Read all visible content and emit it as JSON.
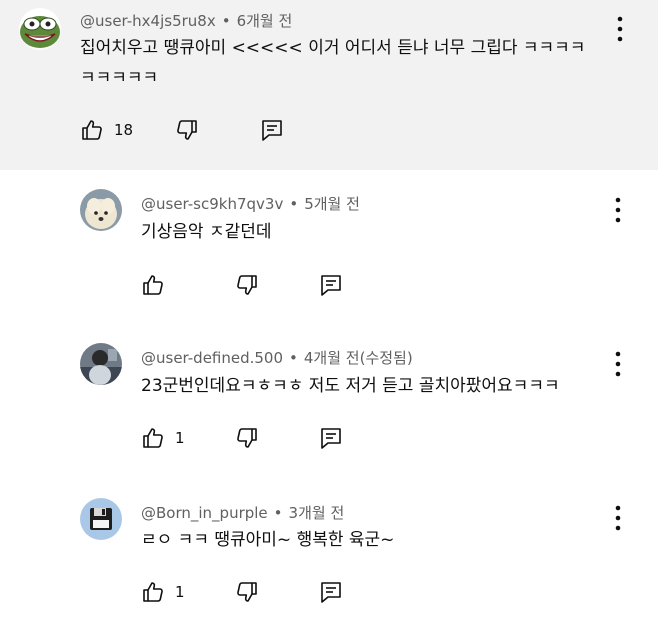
{
  "comments": [
    {
      "author": "@user-hx4js5ru8x",
      "separator": "•",
      "time": "6개월 전",
      "text_line1": "집어치우고 땡큐아미 <<<<< 이거 어디서 듣냐 너무 그립다 ㅋㅋㅋㅋ",
      "text_line2": "ㅋㅋㅋㅋㅋ",
      "like_count": "18",
      "avatar_icon": "pepe-frog-avatar",
      "highlighted_bg": "#f2f2f2"
    },
    {
      "author": "@user-sc9kh7qv3v",
      "separator": "•",
      "time": "5개월 전",
      "text_line1": "기상음악 ㅈ같던데",
      "like_count": "",
      "avatar_icon": "dog-avatar"
    },
    {
      "author": "@user-defined.500",
      "separator": "•",
      "time": "4개월 전(수정됨)",
      "text_line1": "23군번인데요ㅋㅎㅋㅎ 저도 저거 듣고 골치아팠어요ㅋㅋㅋ",
      "like_count": "1",
      "avatar_icon": "photo-avatar"
    },
    {
      "author": "@Born_in_purple",
      "separator": "•",
      "time": "3개월 전",
      "text_line1": "ㄹㅇ ㅋㅋ 땡큐아미~ 행복한 육군~",
      "like_count": "1",
      "avatar_icon": "floppy-disk-avatar"
    }
  ]
}
